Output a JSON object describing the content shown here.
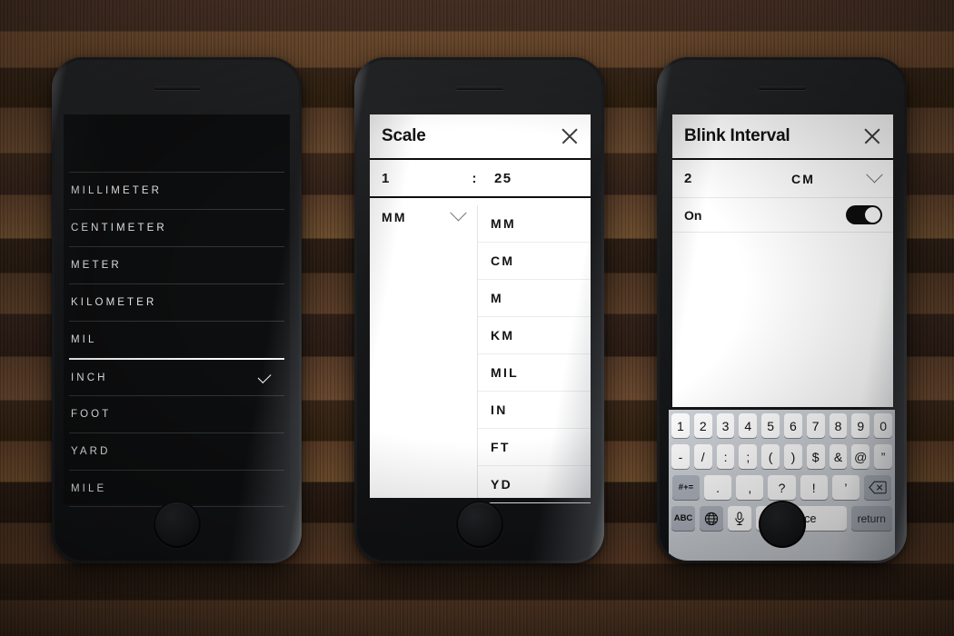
{
  "scene": {
    "background": "#4a3424",
    "accent": "#0d0d0d"
  },
  "phone1": {
    "name": "unit-list-screen",
    "theme_bg": "#0d0e0f",
    "items": [
      {
        "label": "MILLIMETER",
        "selected": false
      },
      {
        "label": "CENTIMETER",
        "selected": false
      },
      {
        "label": "METER",
        "selected": false
      },
      {
        "label": "KILOMETER",
        "selected": false
      },
      {
        "label": "MIL",
        "selected": false
      },
      {
        "label": "INCH",
        "selected": true
      },
      {
        "label": "FOOT",
        "selected": false
      },
      {
        "label": "YARD",
        "selected": false
      },
      {
        "label": "MILE",
        "selected": false
      }
    ],
    "check_icon": "check-icon"
  },
  "phone2": {
    "name": "scale-dialog",
    "title": "Scale",
    "close_icon": "close-icon",
    "ratio_left": "1",
    "separator": ":",
    "ratio_right": "25",
    "unit_value": "MM",
    "chevron_icon": "chevron-down-icon",
    "dropdown_options": [
      "MM",
      "CM",
      "M",
      "KM",
      "MIL",
      "IN",
      "FT",
      "YD"
    ]
  },
  "phone3": {
    "name": "blink-interval-dialog",
    "title": "Blink Interval",
    "close_icon": "close-icon",
    "value": "2",
    "unit_value": "CM",
    "chevron_icon": "chevron-down-icon",
    "toggle_label": "On",
    "toggle_state": "on",
    "keyboard": {
      "row1": [
        "1",
        "2",
        "3",
        "4",
        "5",
        "6",
        "7",
        "8",
        "9",
        "0"
      ],
      "row2": [
        "-",
        "/",
        ":",
        ";",
        "(",
        ")",
        "$",
        "&",
        "@",
        "”"
      ],
      "row3_mode": "#+=",
      "row3": [
        ".",
        ",",
        "?",
        "!",
        "’"
      ],
      "row3_backspace": "backspace-icon",
      "row4_abc": "ABC",
      "row4_globe": "globe-icon",
      "row4_mic": "microphone-icon",
      "row4_space": "space",
      "row4_return": "return"
    }
  }
}
